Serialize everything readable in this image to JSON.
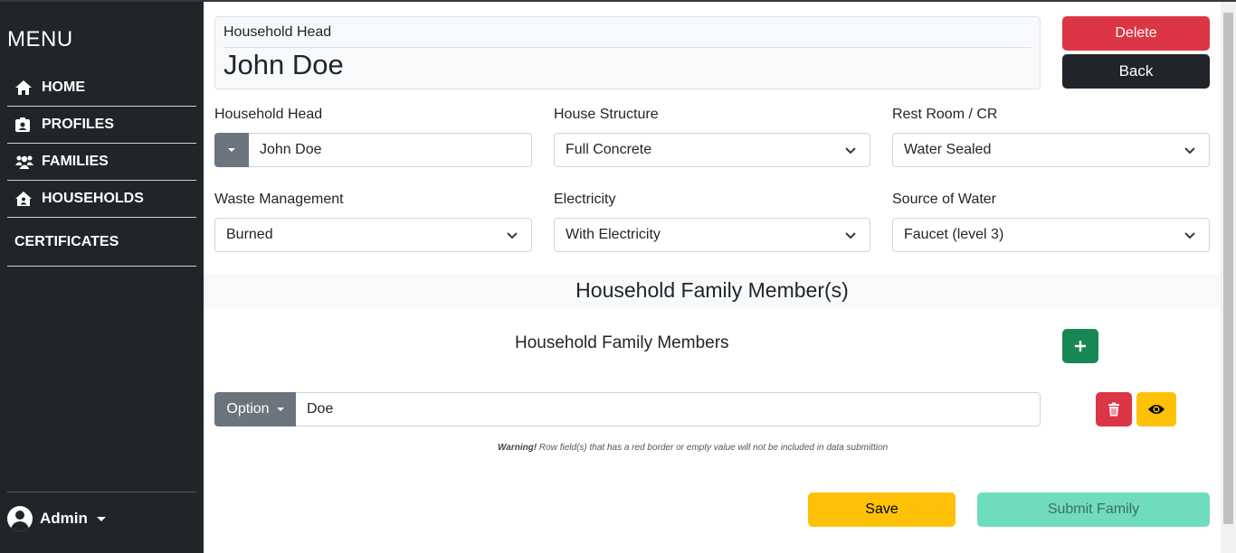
{
  "sidebar": {
    "menu_title": "MENU",
    "items": [
      {
        "label": "HOME",
        "icon": "home-icon"
      },
      {
        "label": "PROFILES",
        "icon": "id-badge-icon"
      },
      {
        "label": "FAMILIES",
        "icon": "users-icon"
      },
      {
        "label": "HOUSEHOLDS",
        "icon": "house-user-icon"
      },
      {
        "label": "CERTIFICATES",
        "icon": ""
      }
    ],
    "user": {
      "name": "Admin",
      "icon": "user-circle-icon"
    }
  },
  "header": {
    "label": "Household Head",
    "name": "John Doe"
  },
  "actions": {
    "delete": "Delete",
    "back": "Back",
    "save": "Save",
    "submit": "Submit Family"
  },
  "form": {
    "household_head": {
      "label": "Household Head",
      "value": "John Doe"
    },
    "house_structure": {
      "label": "House Structure",
      "value": "Full Concrete"
    },
    "rest_room": {
      "label": "Rest Room / CR",
      "value": "Water Sealed"
    },
    "waste_management": {
      "label": "Waste Management",
      "value": "Burned"
    },
    "electricity": {
      "label": "Electricity",
      "value": "With Electricity"
    },
    "source_of_water": {
      "label": "Source of Water",
      "value": "Faucet (level 3)"
    }
  },
  "members_section": {
    "bar_title": "Household Family Member(s)",
    "title": "Household Family Members",
    "rows": [
      {
        "option_label": "Option",
        "value": "Doe"
      }
    ],
    "warning_strong": "Warning!",
    "warning_text": " Row field(s) that has a red border or empty value will not be included in data submittion"
  },
  "colors": {
    "sidebar_bg": "#212529",
    "danger": "#dc3545",
    "success": "#198754",
    "warning": "#ffc107",
    "submit_disabled": "#6fdcbd"
  }
}
